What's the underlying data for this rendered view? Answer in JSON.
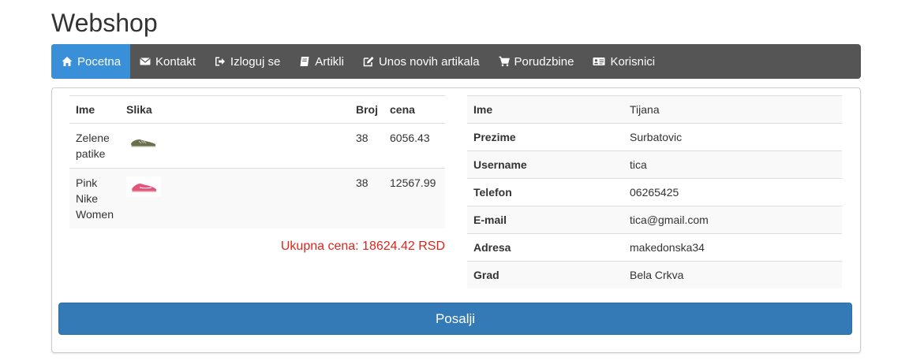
{
  "app": {
    "title": "Webshop"
  },
  "nav": {
    "items": [
      {
        "label": "Pocetna",
        "icon": "home-icon",
        "active": true
      },
      {
        "label": "Kontakt",
        "icon": "envelope-icon",
        "active": false
      },
      {
        "label": "Izloguj se",
        "icon": "sign-out-icon",
        "active": false
      },
      {
        "label": "Artikli",
        "icon": "book-icon",
        "active": false
      },
      {
        "label": "Unos novih artikala",
        "icon": "edit-icon",
        "active": false
      },
      {
        "label": "Porudzbine",
        "icon": "cart-icon",
        "active": false
      },
      {
        "label": "Korisnici",
        "icon": "id-card-icon",
        "active": false
      }
    ],
    "colors": {
      "bar": "#555555",
      "active": "#3a8fd9"
    }
  },
  "cart": {
    "headers": {
      "name": "Ime",
      "image": "Slika",
      "size": "Broj",
      "price": "cena"
    },
    "rows": [
      {
        "name": "Zelene patike",
        "image_icon": "green-sneaker-thumbnail",
        "size": "38",
        "price": "6056.43"
      },
      {
        "name": "Pink Nike Women",
        "image_icon": "pink-sneaker-thumbnail",
        "size": "38",
        "price": "12567.99"
      }
    ],
    "total": "Ukupna cena: 18624.42 RSD",
    "total_color": "#d9261c"
  },
  "customer": {
    "rows": [
      {
        "label": "Ime",
        "value": "Tijana"
      },
      {
        "label": "Prezime",
        "value": "Surbatovic"
      },
      {
        "label": "Username",
        "value": "tica"
      },
      {
        "label": "Telefon",
        "value": "06265425"
      },
      {
        "label": "E-mail",
        "value": "tica@gmail.com"
      },
      {
        "label": "Adresa",
        "value": "makedonska34"
      },
      {
        "label": "Grad",
        "value": "Bela Crkva"
      }
    ]
  },
  "actions": {
    "send_label": "Posalji",
    "send_color": "#337ab7"
  }
}
